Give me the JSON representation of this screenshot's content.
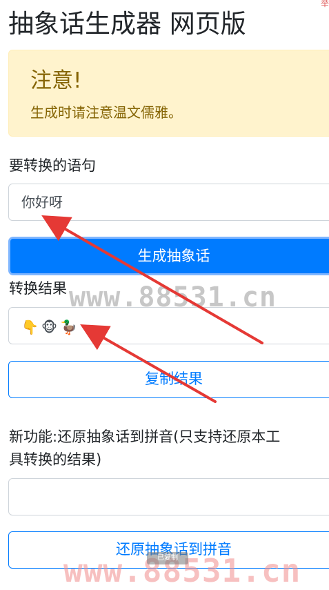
{
  "page_title": "抽象话生成器 网页版",
  "corner_glyph": "举",
  "alert": {
    "heading": "注意!",
    "body": "生成时请注意温文儒雅。"
  },
  "input_section": {
    "label": "要转换的语句",
    "value": "你好呀"
  },
  "generate_button": "生成抽象话",
  "result_section": {
    "label": "转换结果",
    "emojis": [
      "👇",
      "🐵",
      "🦆"
    ]
  },
  "copy_button": "复制结果",
  "restore_section": {
    "label_line1": "新功能:还原抽象话到拼音(只支持还原本工",
    "label_line2": "具转换的结果)",
    "value": ""
  },
  "restore_button": "还原抽象话到拼音",
  "watermarks": {
    "middle": "www.88531.cn",
    "bottom": "www.88531.cn"
  },
  "toast_text": "已复制",
  "colors": {
    "primary": "#007bff",
    "alert_bg": "#fff3cd",
    "alert_text": "#856404",
    "arrow": "#e53935"
  }
}
